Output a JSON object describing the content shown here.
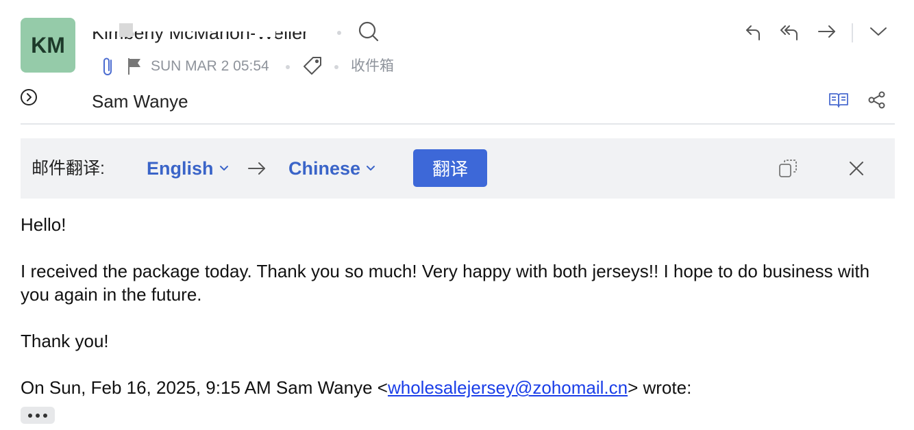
{
  "sender": {
    "avatar_initials": "KM",
    "name": "Kimberly McMahon-Weller",
    "avatar_color": "#95cba9"
  },
  "meta": {
    "date": "SUN MAR 2 05:54",
    "folder": "收件箱"
  },
  "recipient": {
    "name": "Sam Wanye"
  },
  "translation": {
    "label": "邮件翻译:",
    "from_lang": "English",
    "to_lang": "Chinese",
    "button_label": "翻译",
    "accent_color": "#3d68d8"
  },
  "message": {
    "greeting": "Hello!",
    "paragraph": "I received the package today. Thank you so much! Very happy with both jerseys!! I hope to do business with you again in the future.",
    "thanks": "Thank you!",
    "quote_prefix": "On Sun, Feb 16, 2025, 9:15 AM Sam Wanye <",
    "quote_email": "wholesalejersey@zohomail.cn",
    "quote_suffix": "> wrote:"
  },
  "icons": [
    "search-icon",
    "reply-icon",
    "reply-all-icon",
    "forward-icon",
    "chevron-down-icon",
    "attachment-icon",
    "flag-icon",
    "tag-icon",
    "expand-circle-icon",
    "reading-book-icon",
    "share-icon",
    "arrow-right-icon",
    "copy-icon",
    "close-icon"
  ]
}
